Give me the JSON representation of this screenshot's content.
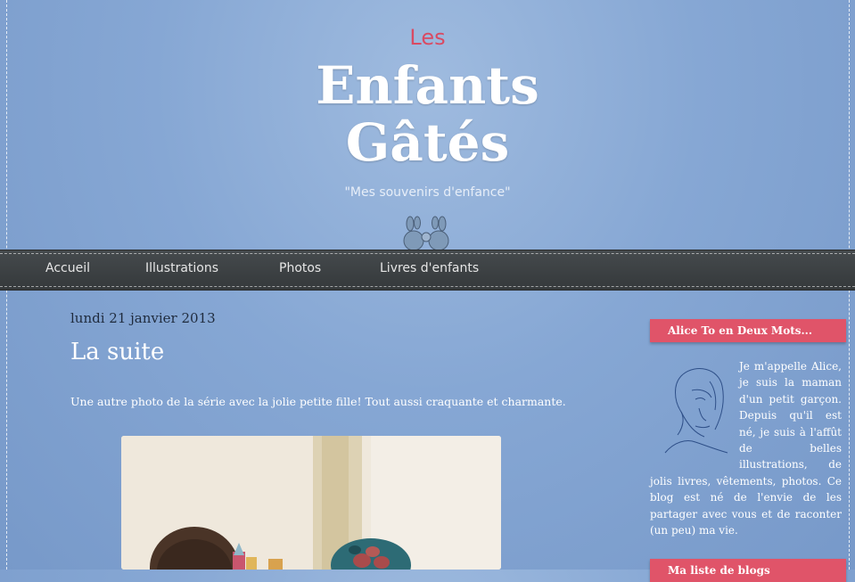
{
  "blog": {
    "title_small": "Les",
    "title_line1": "Enfants",
    "title_line2": "Gâtés",
    "tagline": "\"Mes souvenirs d'enfance\""
  },
  "nav": {
    "items": [
      {
        "label": "Accueil"
      },
      {
        "label": "Illustrations"
      },
      {
        "label": "Photos"
      },
      {
        "label": "Livres d'enfants"
      }
    ]
  },
  "post": {
    "date": "lundi 21 janvier 2013",
    "title": "La suite",
    "body": "Une autre photo de la série avec la jolie petite fille! Tout aussi craquante et charmante."
  },
  "sidebar": {
    "about_title": "Alice To en Deux Mots...",
    "about_text": "Je m'appelle Alice, je suis la maman d'un petit garçon. Depuis qu'il est né, je suis à l'affût de belles illustrations, de jolis livres, vêtements, photos. Ce blog est né de l'envie de les partager avec vous et de raconter (un peu) ma vie.",
    "bloglist_title": "Ma liste de blogs"
  },
  "colors": {
    "background": "#86a7d4",
    "accent": "#e05469",
    "nav": "#3e4245"
  }
}
